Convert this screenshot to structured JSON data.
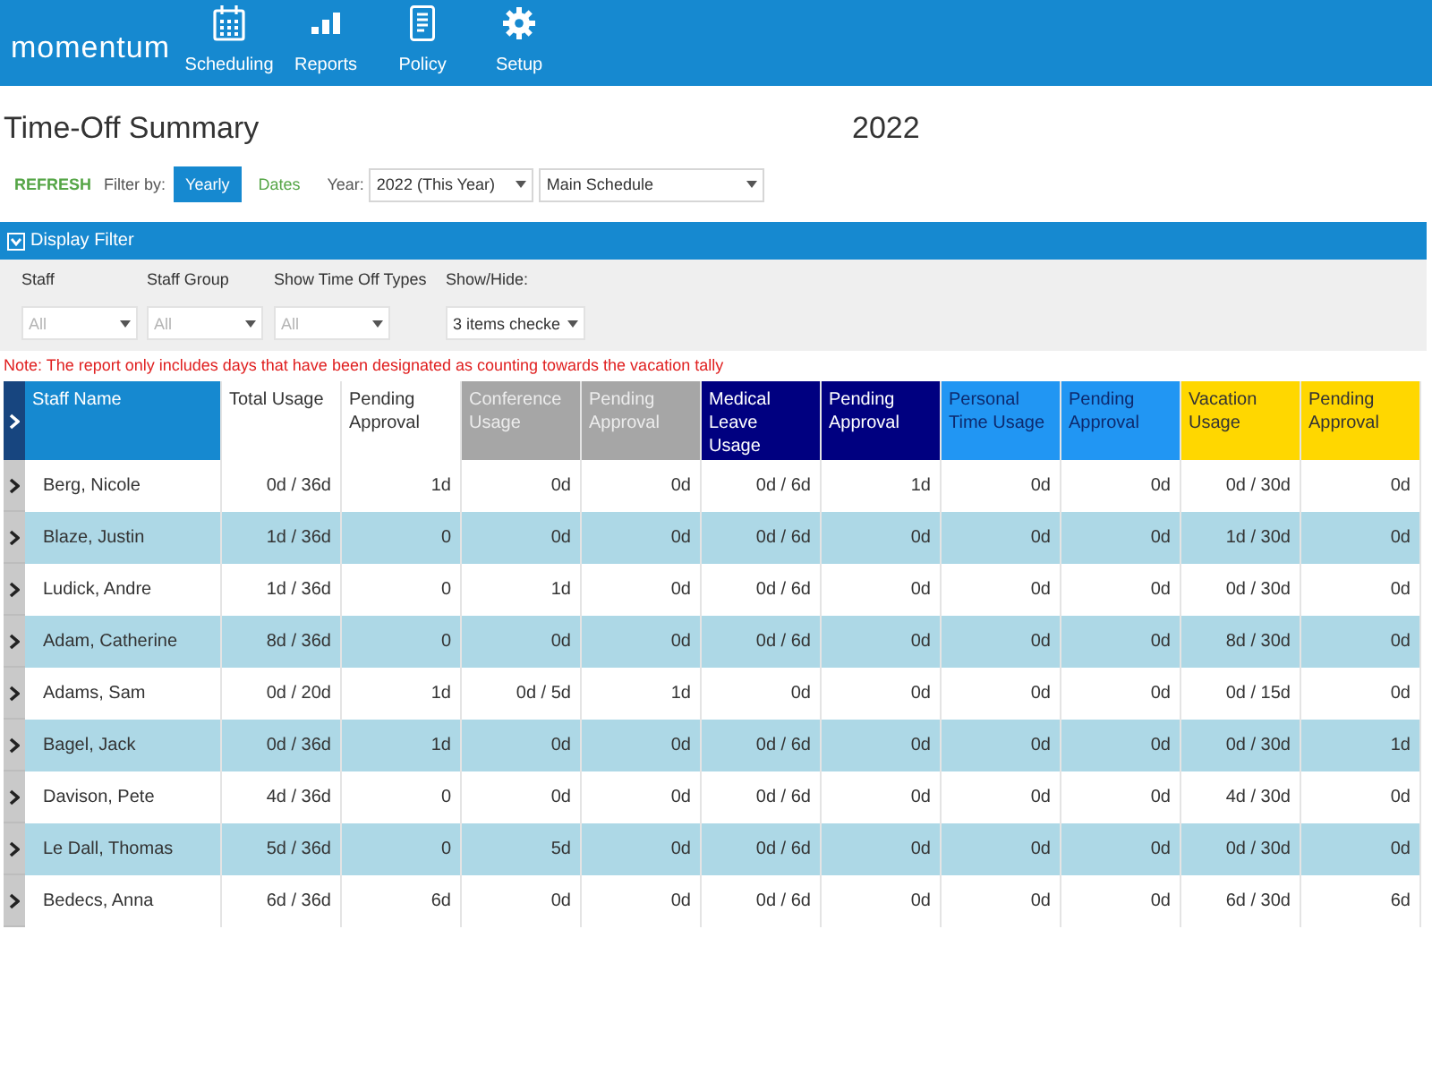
{
  "header": {
    "logo": "momentum",
    "nav": [
      {
        "label": "Scheduling",
        "kind": "calendar"
      },
      {
        "label": "Reports",
        "kind": "chart"
      },
      {
        "label": "Policy",
        "kind": "document"
      },
      {
        "label": "Setup",
        "kind": "gear"
      }
    ]
  },
  "page": {
    "title": "Time-Off Summary",
    "year_heading": "2022"
  },
  "toolbar": {
    "refresh": "REFRESH",
    "filter_label": "Filter by:",
    "filter_options": [
      {
        "label": "Yearly",
        "selected": true
      },
      {
        "label": "Dates",
        "selected": false
      }
    ],
    "year_label": "Year:",
    "year_select": {
      "value": "2022 (This Year)"
    },
    "schedule_select": {
      "value": "Main Schedule"
    }
  },
  "display_filter": {
    "title": "Display Filter",
    "expanded": true,
    "fields": [
      {
        "label": "Staff",
        "value": "All",
        "disabled": true
      },
      {
        "label": "Staff Group",
        "value": "All",
        "disabled": true
      },
      {
        "label": "Show Time Off Types",
        "value": "All",
        "disabled": true
      },
      {
        "label": "Show/Hide:",
        "value": "3 items checke",
        "disabled": false
      }
    ]
  },
  "note": "Note: The report only includes days that have been designated as counting towards the vacation tally",
  "table": {
    "columns": [
      {
        "label": "Staff Name",
        "color": "#1689d0"
      },
      {
        "label": "Total Usage",
        "color": "#ffffff"
      },
      {
        "label": "Pending Approval",
        "color": "#ffffff"
      },
      {
        "label": "Conference Usage",
        "color": "#a6a6a6"
      },
      {
        "label": "Pending Approval",
        "color": "#a6a6a6"
      },
      {
        "label": "Medical Leave Usage",
        "color": "#000080"
      },
      {
        "label": "Pending Approval",
        "color": "#000080"
      },
      {
        "label": "Personal Time Usage",
        "color": "#2196f3"
      },
      {
        "label": "Pending Approval",
        "color": "#2196f3"
      },
      {
        "label": "Vacation Usage",
        "color": "#ffd700"
      },
      {
        "label": "Pending Approval",
        "color": "#ffd700"
      }
    ],
    "rows": [
      {
        "expanded": false,
        "cells": [
          "Berg, Nicole",
          "0d / 36d",
          "1d",
          "0d",
          "0d",
          "0d / 6d",
          "1d",
          "0d",
          "0d",
          "0d / 30d",
          "0d"
        ]
      },
      {
        "expanded": false,
        "cells": [
          "Blaze, Justin",
          "1d / 36d",
          "0",
          "0d",
          "0d",
          "0d / 6d",
          "0d",
          "0d",
          "0d",
          "1d / 30d",
          "0d"
        ]
      },
      {
        "expanded": false,
        "cells": [
          "Ludick, Andre",
          "1d / 36d",
          "0",
          "1d",
          "0d",
          "0d / 6d",
          "0d",
          "0d",
          "0d",
          "0d / 30d",
          "0d"
        ]
      },
      {
        "expanded": false,
        "cells": [
          "Adam, Catherine",
          "8d / 36d",
          "0",
          "0d",
          "0d",
          "0d / 6d",
          "0d",
          "0d",
          "0d",
          "8d / 30d",
          "0d"
        ]
      },
      {
        "expanded": false,
        "cells": [
          "Adams, Sam",
          "0d / 20d",
          "1d",
          "0d / 5d",
          "1d",
          "0d",
          "0d",
          "0d",
          "0d",
          "0d / 15d",
          "0d"
        ]
      },
      {
        "expanded": false,
        "cells": [
          "Bagel, Jack",
          "0d / 36d",
          "1d",
          "0d",
          "0d",
          "0d / 6d",
          "0d",
          "0d",
          "0d",
          "0d / 30d",
          "1d"
        ]
      },
      {
        "expanded": false,
        "cells": [
          "Davison, Pete",
          "4d / 36d",
          "0",
          "0d",
          "0d",
          "0d / 6d",
          "0d",
          "0d",
          "0d",
          "4d / 30d",
          "0d"
        ]
      },
      {
        "expanded": false,
        "cells": [
          "Le Dall, Thomas",
          "5d / 36d",
          "0",
          "5d",
          "0d",
          "0d / 6d",
          "0d",
          "0d",
          "0d",
          "0d / 30d",
          "0d"
        ]
      },
      {
        "expanded": false,
        "cells": [
          "Bedecs, Anna",
          "6d / 36d",
          "6d",
          "0d",
          "0d",
          "0d / 6d",
          "0d",
          "0d",
          "0d",
          "6d / 30d",
          "6d"
        ]
      }
    ]
  }
}
